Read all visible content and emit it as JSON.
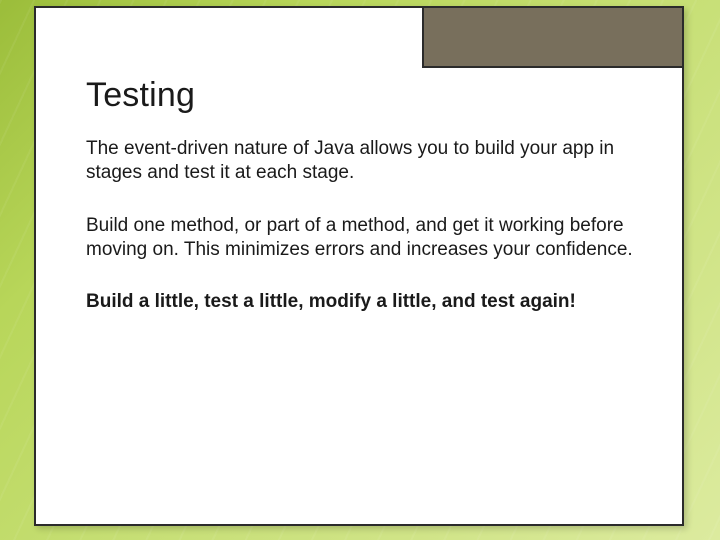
{
  "slide": {
    "title": "Testing",
    "paragraphs": [
      {
        "text": "The event-driven nature of Java allows you to build your app in stages and test it at each stage.",
        "bold": false
      },
      {
        "text": "Build one method, or part of a method, and get it working before moving on.  This minimizes errors and increases your confidence.",
        "bold": false
      },
      {
        "text": "Build a little, test a little, modify a little, and test again!",
        "bold": true
      }
    ]
  },
  "theme": {
    "accent_box_color": "#786f5c",
    "card_border": "#2b2b2b",
    "bg_gradient_start": "#9bbd3a",
    "bg_gradient_end": "#dceb9f"
  }
}
